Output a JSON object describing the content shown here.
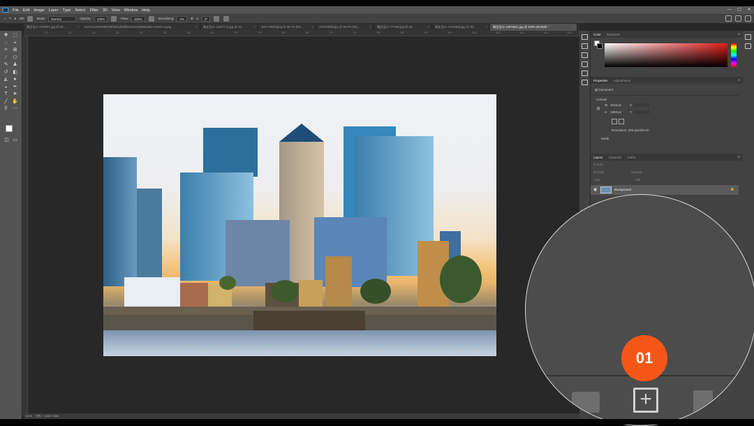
{
  "menubar": {
    "items": [
      "File",
      "Edit",
      "Image",
      "Layer",
      "Type",
      "Select",
      "Filter",
      "3D",
      "View",
      "Window",
      "Help"
    ],
    "logo": "Ps"
  },
  "window_controls": [
    "—",
    "▢",
    "✕"
  ],
  "options": {
    "mode_label": "Mode:",
    "mode_value": "Normal",
    "opacity_label": "Opacity:",
    "opacity_value": "100%",
    "flow_label": "Flow:",
    "flow_value": "100%",
    "smoothing_label": "Smoothing:",
    "smoothing_value": "0%",
    "angle_value": "0°",
    "brush_size": "300"
  },
  "tabs": [
    {
      "label": "稿定设计-3729974.jpg @ 50...",
      "active": false
    },
    {
      "label": "24472c1b2039f64f39f35422b6fab0e1b1a2836a339a-Vm6FA4.jpeg",
      "active": false
    },
    {
      "label": "稿定设计-14547711.jpg @ 33...",
      "active": false
    },
    {
      "label": "202719029.jpeg @ 66.7% (RG...",
      "active": false
    },
    {
      "label": "202719028.jpg @ 66.7% (RG...",
      "active": false
    },
    {
      "label": "稿定设计-777495.jpg @ 33...",
      "active": false
    },
    {
      "label": "稿定设计-17015645.jpg @ 25...",
      "active": false
    },
    {
      "label": "稿定设计-14979541.jpg @ 100% (RGB/8) *",
      "active": true
    }
  ],
  "ruler": [
    "10",
    "15",
    "20",
    "25",
    "30",
    "35",
    "40",
    "45",
    "50",
    "55",
    "60",
    "65",
    "70",
    "75",
    "80",
    "85",
    "90",
    "95",
    "100",
    "105",
    "110",
    "115",
    "120"
  ],
  "status": {
    "zoom": "100%",
    "doc": "文档: 7.58M/7.58M"
  },
  "color_panel": {
    "tabs": [
      "Color",
      "Swatches"
    ]
  },
  "properties_panel": {
    "tabs": [
      "Properties",
      "Adjustments"
    ],
    "doc_label": "Document",
    "canvas_label": "Canvas",
    "w_label": "W",
    "w_value": "3048 px",
    "h_label": "H",
    "h_value": "1358 px",
    "x_label": "X",
    "y_label": "Y",
    "resolution": "Resolution: 300 pixels/inch",
    "mode": "Mode"
  },
  "layers_panel": {
    "tabs": [
      "Layers",
      "Channels",
      "Paths"
    ],
    "kind": "Kind",
    "blend": "Normal",
    "opacity": "Opacity:",
    "lock": "Lock:",
    "fill": "Fill:",
    "layer_name": "Background"
  },
  "callout": {
    "badge": "01"
  },
  "colors": {
    "accent": "#f45716",
    "panel": "#424242",
    "menubar": "#535353"
  }
}
